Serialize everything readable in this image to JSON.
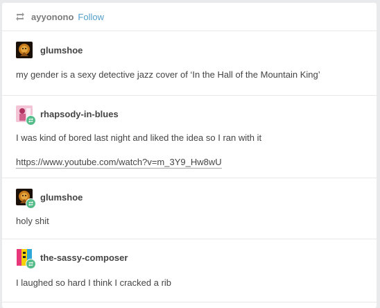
{
  "header": {
    "author": "ayyonono",
    "follow_label": "Follow"
  },
  "entries": [
    {
      "username": "glumshoe",
      "reblogged": false,
      "avatar_icon": "lion-avatar-icon",
      "text": "my gender is a sexy detective jazz cover of ‘In the Hall of the Mountain King’"
    },
    {
      "username": "rhapsody-in-blues",
      "reblogged": true,
      "avatar_icon": "pink-figure-avatar-icon",
      "text": "I was kind of bored last night and liked the idea so I ran with it",
      "link": "https://www.youtube.com/watch?v=m_3Y9_Hw8wU"
    },
    {
      "username": "glumshoe",
      "reblogged": true,
      "avatar_icon": "lion-avatar-icon",
      "text": "holy shit"
    },
    {
      "username": "the-sassy-composer",
      "reblogged": true,
      "avatar_icon": "colorful-avatar-icon",
      "text": "I laughed so hard I think I cracked a rib"
    }
  ],
  "colors": {
    "accent_link": "#529ecc",
    "reblog_green": "#56bc8a",
    "text": "#444444"
  }
}
